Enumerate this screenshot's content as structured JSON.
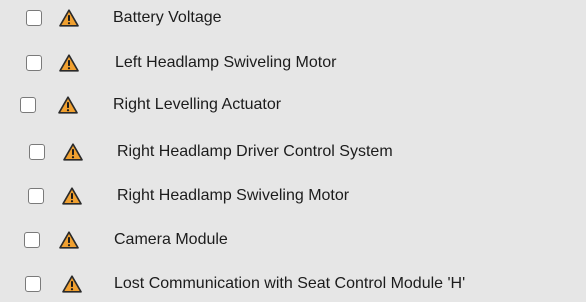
{
  "alerts": {
    "items": [
      {
        "label": "Battery Voltage",
        "checked": false,
        "icon": "warning-icon"
      },
      {
        "label": "Left Headlamp Swiveling Motor",
        "checked": false,
        "icon": "warning-icon"
      },
      {
        "label": "Right Levelling Actuator",
        "checked": false,
        "icon": "warning-icon"
      },
      {
        "label": "Right Headlamp Driver Control System",
        "checked": false,
        "icon": "warning-icon"
      },
      {
        "label": "Right Headlamp Swiveling Motor",
        "checked": false,
        "icon": "warning-icon"
      },
      {
        "label": "Camera Module",
        "checked": false,
        "icon": "warning-icon"
      },
      {
        "label": "Lost Communication with Seat Control Module 'H'",
        "checked": false,
        "icon": "warning-icon"
      }
    ]
  },
  "colors": {
    "background": "#e6e6e6",
    "warning_fill": "#f0a030",
    "warning_stroke": "#2a2a2a",
    "checkbox_border": "#7a7a7a"
  }
}
